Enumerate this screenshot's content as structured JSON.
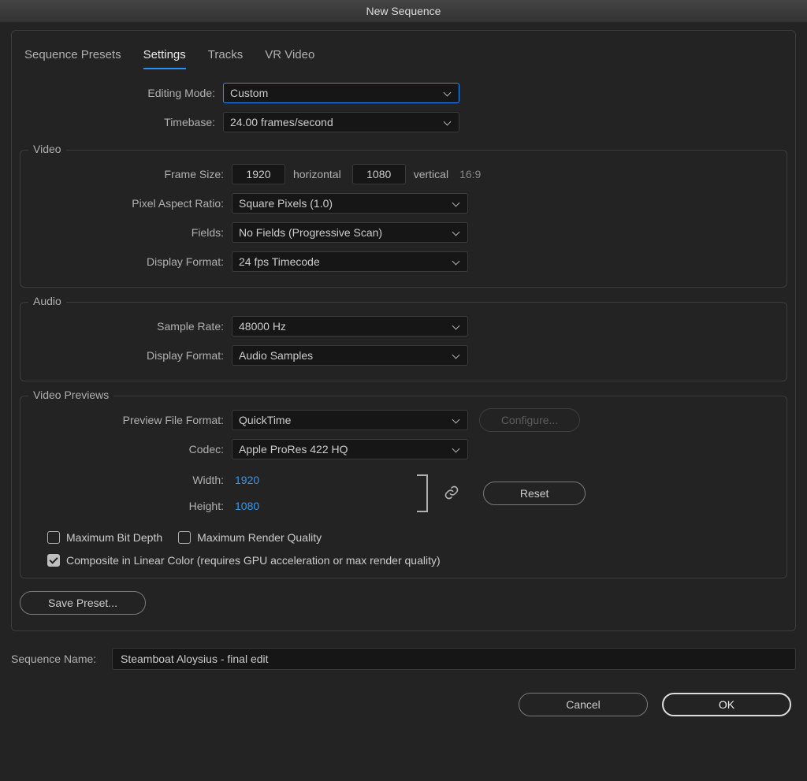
{
  "window": {
    "title": "New Sequence"
  },
  "tabs": {
    "presets": "Sequence Presets",
    "settings": "Settings",
    "tracks": "Tracks",
    "vr": "VR Video"
  },
  "editing_mode": {
    "label": "Editing Mode:",
    "value": "Custom"
  },
  "timebase": {
    "label": "Timebase:",
    "value": "24.00  frames/second"
  },
  "video": {
    "legend": "Video",
    "frame_size_label": "Frame Size:",
    "width": "1920",
    "horizontal": "horizontal",
    "height": "1080",
    "vertical": "vertical",
    "aspect": "16:9",
    "par_label": "Pixel Aspect Ratio:",
    "par_value": "Square Pixels (1.0)",
    "fields_label": "Fields:",
    "fields_value": "No Fields (Progressive Scan)",
    "disp_label": "Display Format:",
    "disp_value": "24 fps Timecode"
  },
  "audio": {
    "legend": "Audio",
    "sr_label": "Sample Rate:",
    "sr_value": "48000 Hz",
    "disp_label": "Display Format:",
    "disp_value": "Audio Samples"
  },
  "previews": {
    "legend": "Video Previews",
    "pff_label": "Preview File Format:",
    "pff_value": "QuickTime",
    "configure": "Configure...",
    "codec_label": "Codec:",
    "codec_value": "Apple ProRes 422 HQ",
    "width_label": "Width:",
    "width_value": "1920",
    "height_label": "Height:",
    "height_value": "1080",
    "reset": "Reset",
    "max_bit_depth": "Maximum Bit Depth",
    "max_render_quality": "Maximum Render Quality",
    "composite_linear": "Composite in Linear Color (requires GPU acceleration or max render quality)"
  },
  "save_preset": "Save Preset...",
  "sequence_name_label": "Sequence Name:",
  "sequence_name_value": "Steamboat Aloysius - final edit",
  "buttons": {
    "cancel": "Cancel",
    "ok": "OK"
  }
}
